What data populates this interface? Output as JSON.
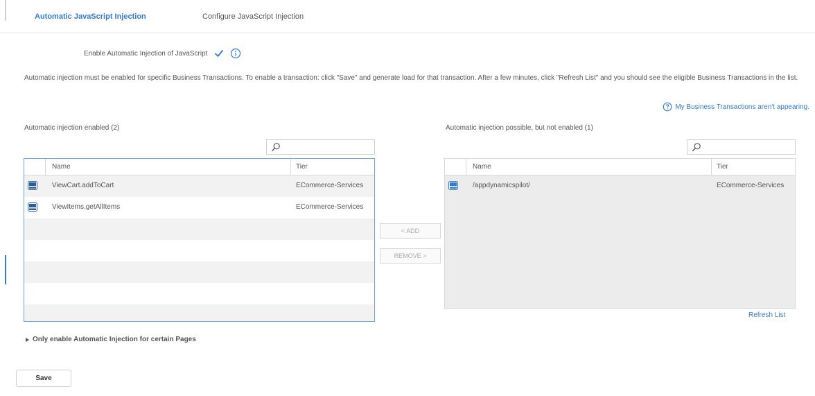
{
  "tabs": [
    {
      "label": "Automatic JavaScript Injection",
      "active": true
    },
    {
      "label": "Configure JavaScript Injection",
      "active": false
    }
  ],
  "enable_injection": {
    "label": "Enable Automatic Injection of JavaScript",
    "checked": true
  },
  "description": "Automatic injection must be enabled for specific Business Transactions. To enable a transaction: click \"Save\" and generate load for that transaction. After a few minutes, click \"Refresh List\" and you should see the eligible Business Transactions in the list.",
  "help_link": "My Business Transactions aren't appearing.",
  "enabled_panel": {
    "label": "Automatic injection enabled (2)",
    "search_placeholder": "",
    "columns": {
      "name": "Name",
      "tier": "Tier"
    },
    "rows": [
      {
        "name": "ViewCart.addToCart",
        "tier": "ECommerce-Services"
      },
      {
        "name": "ViewItems.getAllItems",
        "tier": "ECommerce-Services"
      }
    ]
  },
  "possible_panel": {
    "label": "Automatic injection possible, but not enabled (1)",
    "search_placeholder": "",
    "columns": {
      "name": "Name",
      "tier": "Tier"
    },
    "rows": [
      {
        "name": "/appdynamicspilot/",
        "tier": "ECommerce-Services"
      }
    ]
  },
  "buttons": {
    "add": "< ADD",
    "remove": "REMOVE >",
    "save": "Save"
  },
  "refresh_link": "Refresh List",
  "pages_section": "Only enable Automatic Injection for certain Pages",
  "colors": {
    "accent": "#2f7bd8",
    "text": "#555555",
    "grid_selected_border": "#6fa3e0"
  }
}
